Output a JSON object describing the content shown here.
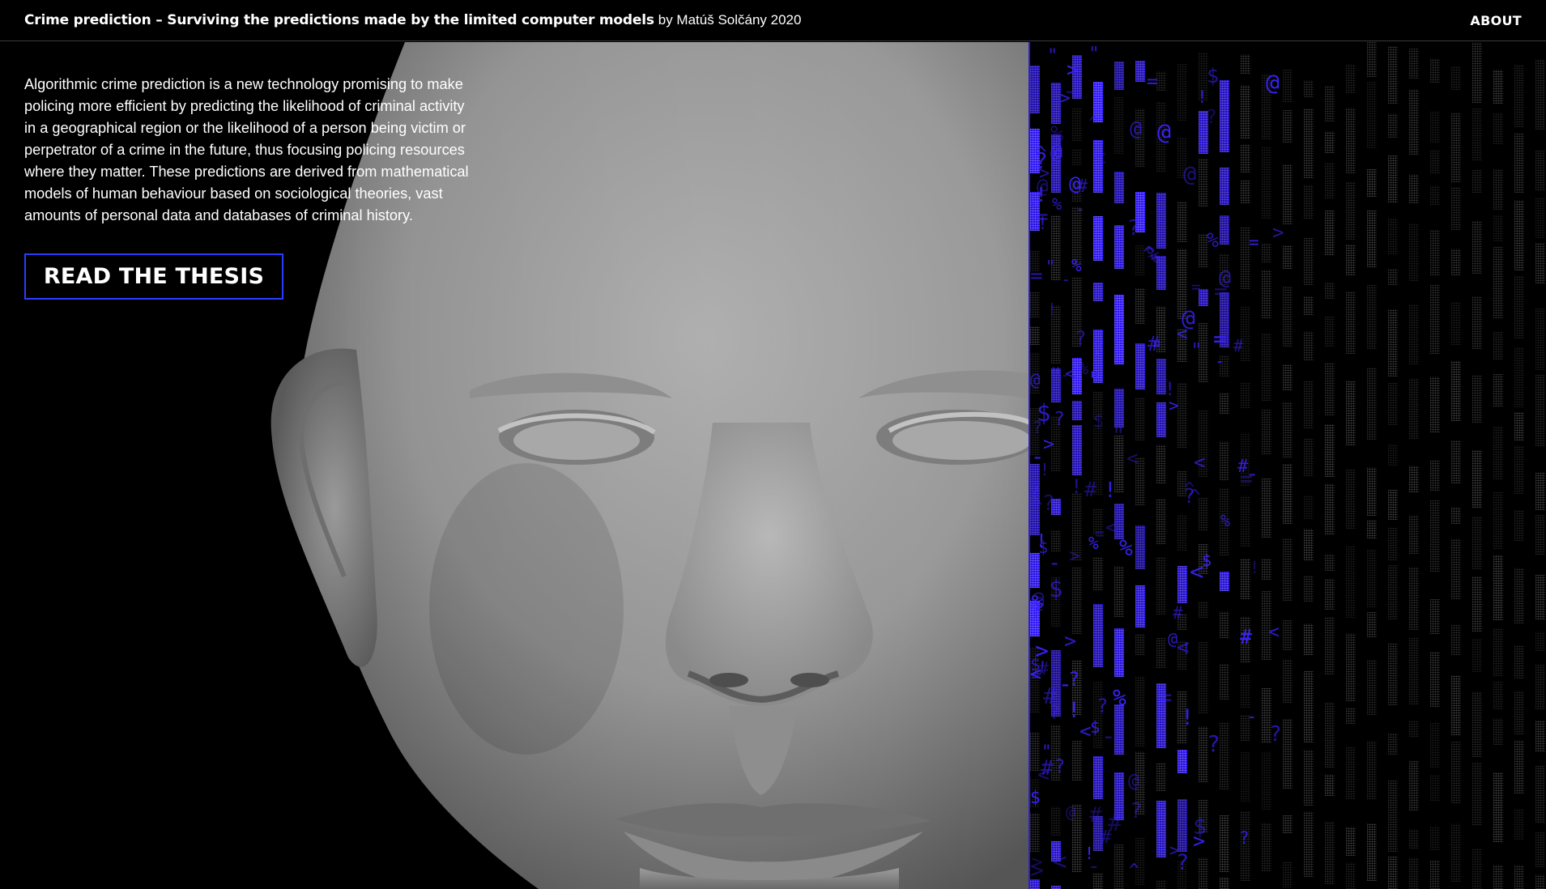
{
  "header": {
    "title": "Crime prediction – Surviving the predictions made by the limited computer models",
    "byline": "by Matúš Solčány 2020",
    "about_label": "ABOUT"
  },
  "intro": {
    "text": "Algorithmic crime prediction is a new technology promising to make policing more efficient by predicting the likelihood of criminal activity in a geographical region or the likelihood of a person being victim or perpetrator of a crime in the future, thus focusing policing resources where they matter. These predictions are derived from mathematical models of human behaviour based on sociological theories, vast amounts of personal data and databases of criminal history.",
    "cta_label": "READ THE THESIS"
  },
  "colors": {
    "background": "#000000",
    "accent_blue": "#2c3cff",
    "glyph_blue": "#3b22ff",
    "text": "#ffffff"
  },
  "matrix": {
    "glyphs": [
      "$",
      "#",
      "^",
      "<",
      ">",
      "\"",
      "!",
      "?",
      "%",
      "@",
      "=",
      "-"
    ]
  }
}
